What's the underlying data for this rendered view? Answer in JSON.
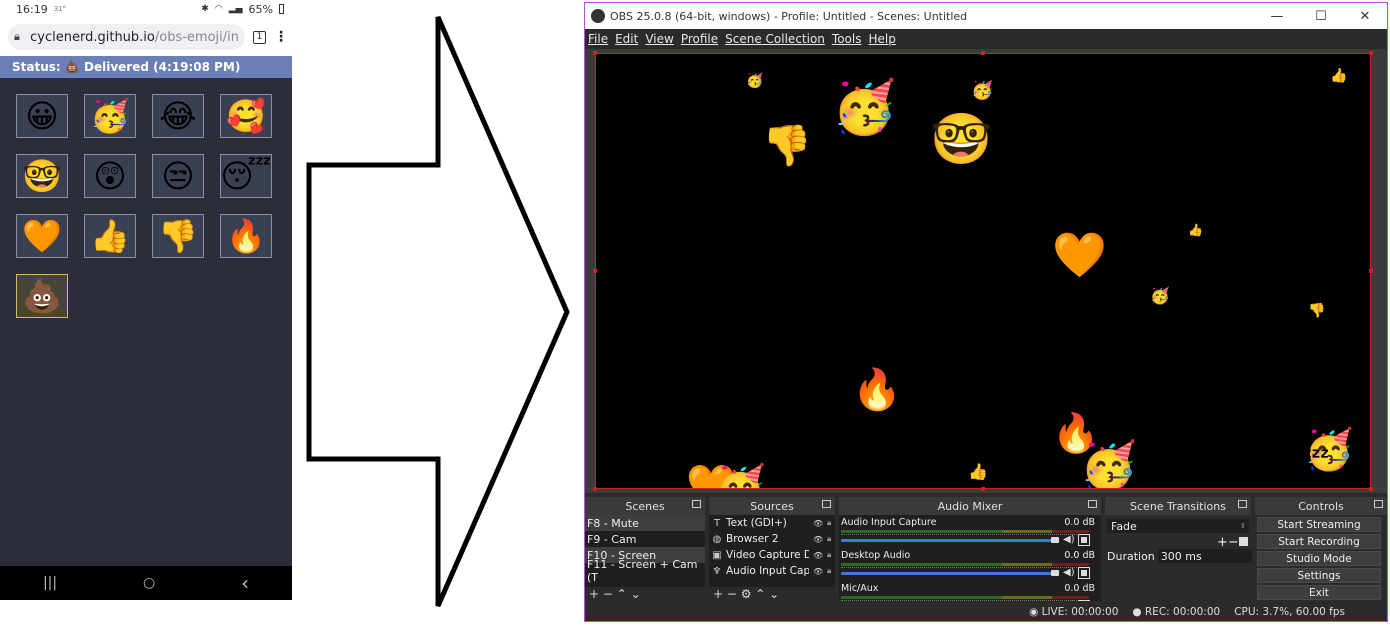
{
  "phone": {
    "status_bar": {
      "time": "16:19",
      "temp": "31°",
      "battery": "65%"
    },
    "url": {
      "host": "cyclenerd.github.io",
      "path": "/obs-emoji/in"
    },
    "tab_count": "1",
    "status_line": "Status: 💩 Delivered (4:19:08 PM)",
    "emojis": [
      "😀",
      "🥳",
      "😂",
      "🥰",
      "🤓",
      "😲",
      "😒",
      "😴",
      "🧡",
      "👍",
      "👎",
      "🔥",
      "💩"
    ],
    "selected_emoji": "💩",
    "nav": {
      "recents": "|||",
      "home": "○",
      "back": "‹"
    }
  },
  "obs": {
    "title": "OBS 25.0.8 (64-bit, windows) - Profile: Untitled - Scenes: Untitled",
    "window_buttons": {
      "minimize": "—",
      "maximize": "☐",
      "close": "✕"
    },
    "menu": [
      "File",
      "Edit",
      "View",
      "Profile",
      "Scene Collection",
      "Tools",
      "Help"
    ],
    "docks": {
      "scenes": {
        "title": "Scenes",
        "items": [
          "F8 - Mute",
          "F9 - Cam",
          "F10 - Screen",
          "F11 - Screen + Cam (T"
        ],
        "selected": "F8 - Mute",
        "footer": "+ −   ⌃ ⌄"
      },
      "sources": {
        "title": "Sources",
        "items": [
          {
            "icon": "T",
            "name": "Text (GDI+)"
          },
          {
            "icon": "◍",
            "name": "Browser 2"
          },
          {
            "icon": "▣",
            "name": "Video Capture Dev"
          },
          {
            "icon": "♆",
            "name": "Audio Input Captu"
          }
        ],
        "footer": "+ − ⚙   ⌃ ⌄"
      },
      "audio_mixer": {
        "title": "Audio Mixer",
        "channels": [
          {
            "name": "Audio Input Capture",
            "db": "0.0 dB"
          },
          {
            "name": "Desktop Audio",
            "db": "0.0 dB"
          },
          {
            "name": "Mic/Aux",
            "db": "0.0 dB"
          }
        ]
      },
      "scene_transitions": {
        "title": "Scene Transitions",
        "transition": "Fade",
        "duration_label": "Duration",
        "duration_value": "300 ms",
        "plus_minus": "+−"
      },
      "controls": {
        "title": "Controls",
        "buttons": [
          "Start Streaming",
          "Start Recording",
          "Studio Mode",
          "Settings",
          "Exit"
        ]
      }
    },
    "status": {
      "live": "LIVE: 00:00:00",
      "rec": "REC: 00:00:00",
      "cpu": "CPU: 3.7%, 60.00 fps"
    },
    "preview_emojis": [
      "😀",
      "🥳",
      "🥳",
      "🥳",
      "😴",
      "👍",
      "👎",
      "🤓",
      "😲",
      "👍",
      "😲",
      "😲",
      "🧡",
      "🥳",
      "😂",
      "👎",
      "😴",
      "🔥",
      "😴",
      "🔥",
      "🥳",
      "🥳",
      "🧡",
      "🥳",
      "👍",
      "😴"
    ]
  }
}
